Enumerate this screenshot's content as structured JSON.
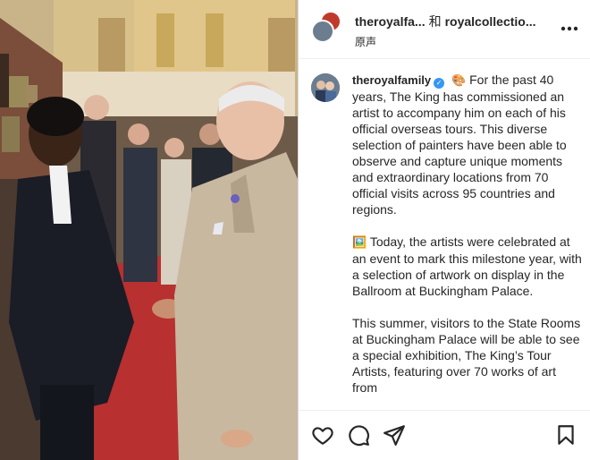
{
  "post": {
    "header": {
      "account_primary": "theroyalfa...",
      "joiner": "和",
      "account_secondary": "royalcollectio...",
      "audio_label": "原声"
    },
    "caption": {
      "username": "theroyalfamily",
      "paragraphs": [
        "For the past 40 years, The King has commissioned an artist to accompany him on each of his official overseas tours. This diverse selection of painters have been able to observe and capture unique moments and extraordinary locations from 70 official visits across 95 countries and regions.",
        "Today, the artists were celebrated at an event to mark this milestone year, with a selection of artwork on display in the Ballroom at Buckingham Palace.",
        "This summer, visitors to the State Rooms at Buckingham Palace will be able to see a special exhibition, The King’s Tour Artists, featuring over 70 works of art from"
      ],
      "emoji_1": "🎨",
      "emoji_2": "🖼️"
    },
    "icons": {
      "like": "heart-icon",
      "comment": "comment-icon",
      "share": "send-icon",
      "save": "bookmark-icon",
      "more": "more-icon",
      "verified": "verified-badge-icon"
    },
    "colors": {
      "verified": "#3897f0",
      "text": "#262626",
      "divider": "#efefef"
    }
  }
}
